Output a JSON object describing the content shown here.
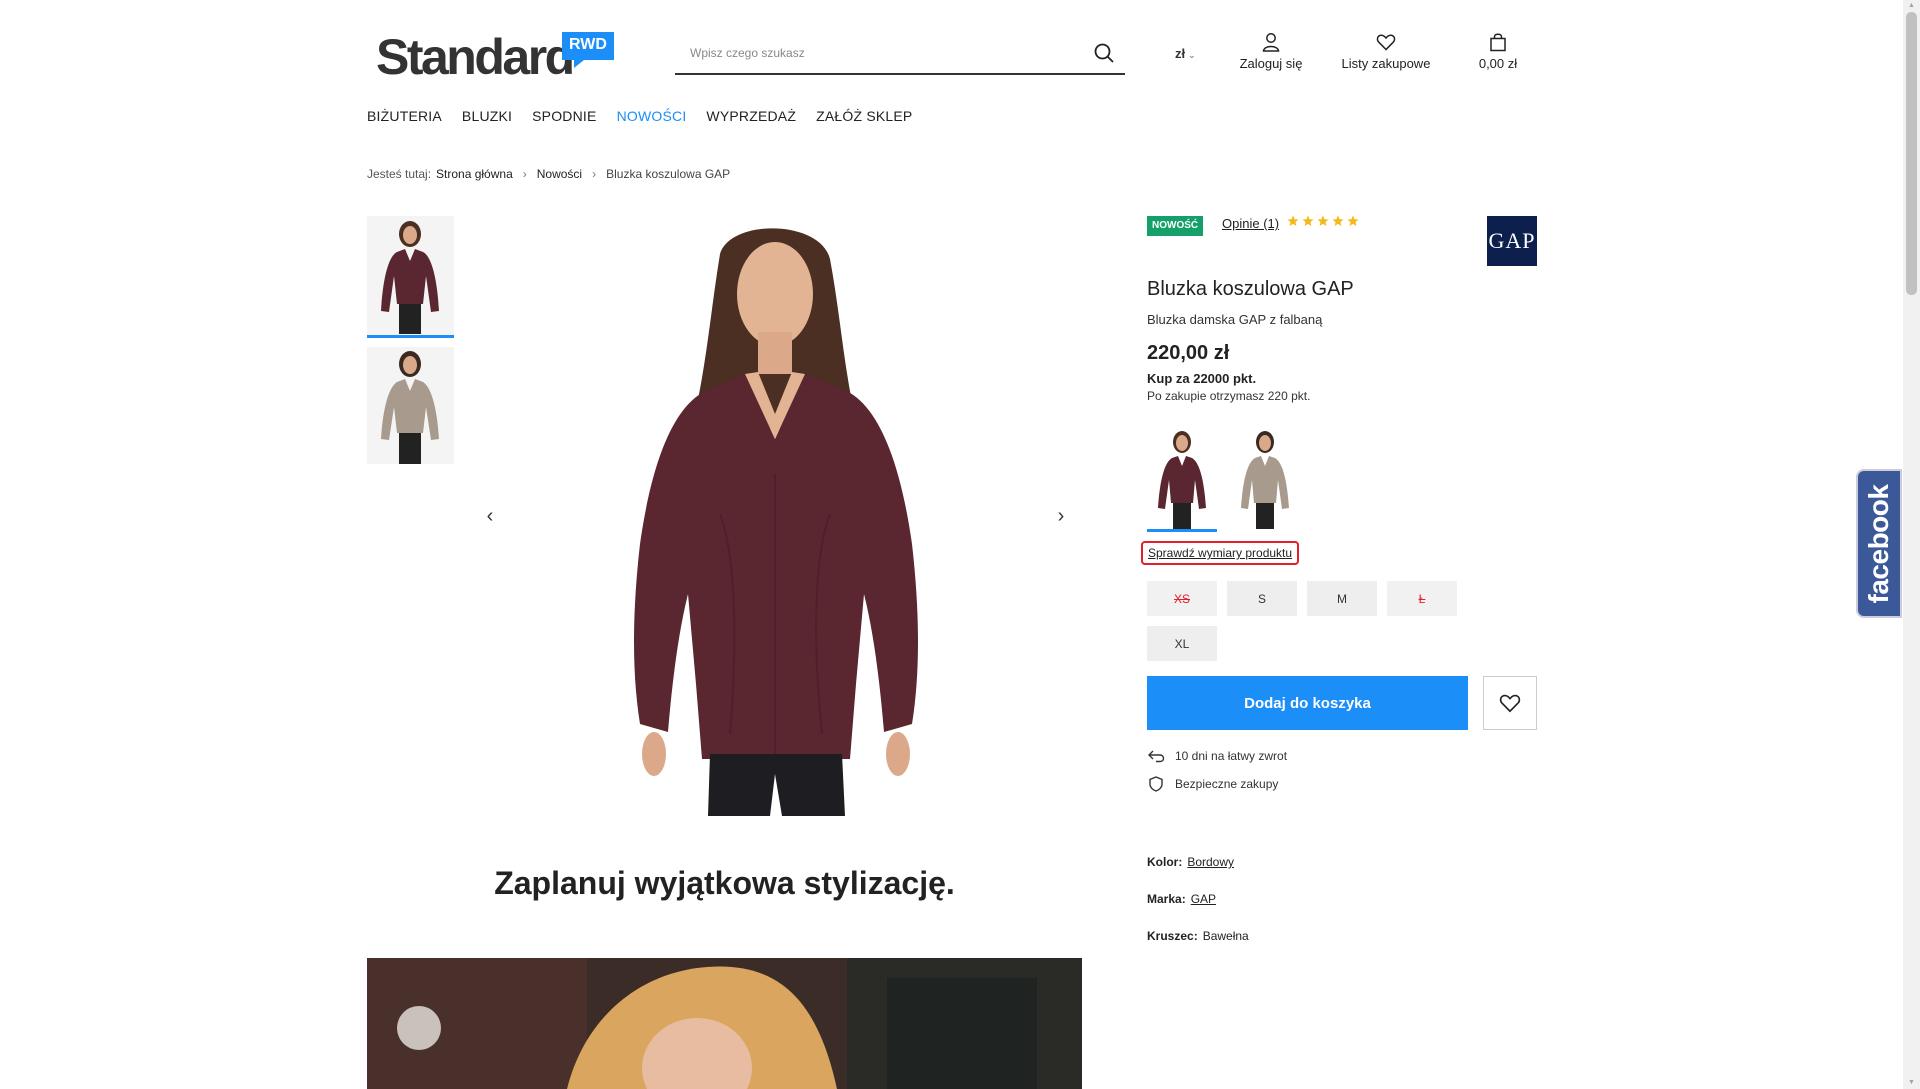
{
  "header": {
    "logo_text": "Standard",
    "logo_badge": "RWD",
    "search_placeholder": "Wpisz czego szukasz",
    "currency": "zł",
    "login_label": "Zaloguj się",
    "lists_label": "Listy zakupowe",
    "cart_total": "0,00 zł"
  },
  "nav": {
    "items": [
      {
        "label": "BIŻUTERIA"
      },
      {
        "label": "BLUZKI"
      },
      {
        "label": "SPODNIE"
      },
      {
        "label": "NOWOŚCI",
        "active": true
      },
      {
        "label": "WYPRZEDAŻ"
      },
      {
        "label": "ZAŁÓŻ SKLEP"
      }
    ]
  },
  "breadcrumb": {
    "lead": "Jesteś tutaj:",
    "items": [
      "Strona główna",
      "Nowości",
      "Bluzka koszulowa GAP"
    ]
  },
  "product": {
    "badge": "NOWOŚĆ",
    "opinions": "Opinie (1)",
    "rating": 5,
    "brand_logo": "GAP",
    "title": "Bluzka koszulowa GAP",
    "subtitle": "Bluzka damska GAP z falbaną",
    "price": "220,00 zł",
    "points_buy": "Kup za 22000 pkt.",
    "points_get": "Po zakupie otrzymasz 220 pkt.",
    "size_link": "Sprawdź wymiary produktu",
    "sizes": [
      {
        "label": "XS",
        "available": false
      },
      {
        "label": "S",
        "available": true
      },
      {
        "label": "M",
        "available": true
      },
      {
        "label": "Ł",
        "available": false
      },
      {
        "label": "XL",
        "available": true
      }
    ],
    "add_to_cart": "Dodaj do koszyka",
    "features": [
      "10 dni na łatwy zwrot",
      "Bezpieczne zakupy"
    ],
    "attributes": [
      {
        "key": "Kolor:",
        "value": "Bordowy"
      },
      {
        "key": "Marka:",
        "value": "GAP"
      },
      {
        "key": "Kruszec:",
        "value": "Bawełna"
      }
    ]
  },
  "gallery": {
    "prev": "‹",
    "next": "›"
  },
  "section": {
    "heading": "Zaplanuj wyjątkowa stylizację."
  },
  "social": {
    "facebook": "facebook"
  },
  "colors": {
    "accent": "#1b8ef7",
    "new_badge": "#15a069",
    "gap_logo": "#0d1f4d",
    "facebook": "#3b5998",
    "burgundy": "#5a2630",
    "beige": "#a89a8c"
  }
}
